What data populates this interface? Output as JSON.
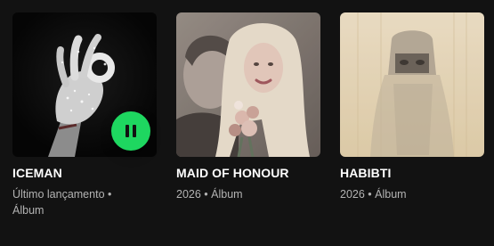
{
  "theme": {
    "background": "#121212",
    "text_primary": "#ffffff",
    "text_secondary": "#b3b3b3",
    "accent": "#1ed760"
  },
  "albums": [
    {
      "title": "ICEMAN",
      "subtitle": "Último lançamento • Álbum",
      "cover_icon": "ok-hand-glove-cover",
      "is_playing": true,
      "control_icon": "pause-icon"
    },
    {
      "title": "MAID OF HONOUR",
      "subtitle": "2026 • Álbum",
      "cover_icon": "couple-photo-cover",
      "is_playing": false
    },
    {
      "title": "HABIBTI",
      "subtitle": "2026 • Álbum",
      "cover_icon": "veiled-portrait-cover",
      "is_playing": false
    }
  ]
}
